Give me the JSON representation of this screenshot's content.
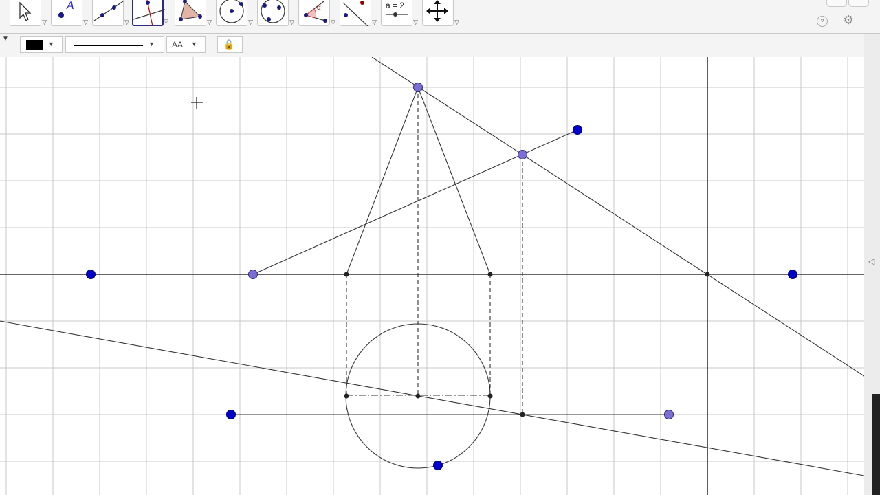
{
  "toolbar": {
    "tools": [
      {
        "name": "move-tool",
        "icon": "arrow-icon"
      },
      {
        "name": "point-tool",
        "icon": "point-icon",
        "label": "A"
      },
      {
        "name": "line-tool",
        "icon": "line-icon"
      },
      {
        "name": "perpendicular-line-tool",
        "icon": "perpendicular-line-icon",
        "selected": true
      },
      {
        "name": "polygon-tool",
        "icon": "polygon-icon"
      },
      {
        "name": "circle-tool",
        "icon": "circle-center-point-icon"
      },
      {
        "name": "circle-three-points-tool",
        "icon": "circle-three-points-icon"
      },
      {
        "name": "angle-tool",
        "icon": "angle-icon",
        "label": "α"
      },
      {
        "name": "reflect-tool",
        "icon": "reflect-icon"
      },
      {
        "name": "slider-tool",
        "icon": "slider-icon",
        "label": "a = 2"
      },
      {
        "name": "move-view-tool",
        "icon": "move-graphics-view-icon"
      }
    ],
    "help_icon_label": "?",
    "gear_icon": "⚙"
  },
  "stylebar": {
    "toggle": "▼",
    "color": "#000000",
    "line_style": "solid",
    "text_size_label": "AA",
    "lock_icon": "🔓"
  },
  "colors": {
    "free_point": "#0000cc",
    "dependent_point": "#7b6fd6",
    "grid": "#c8c8c8",
    "axis": "#333333",
    "line": "#333333"
  }
}
